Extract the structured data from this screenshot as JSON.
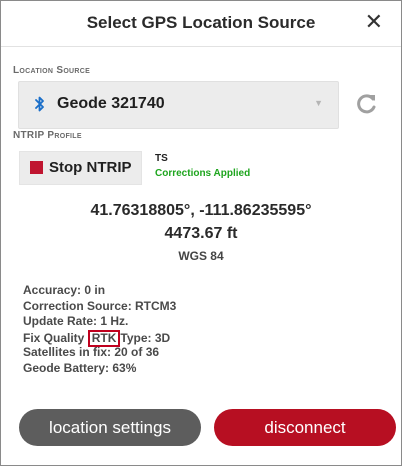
{
  "dialog": {
    "title": "Select GPS Location Source",
    "close_symbol": "✕"
  },
  "location_source": {
    "label": "Location Source",
    "selected": "Geode 321740",
    "icon": "bluetooth-icon",
    "refresh_icon": "refresh-icon"
  },
  "ntrip": {
    "label": "NTRIP Profile",
    "stop_label": "Stop NTRIP",
    "profile_name": "TS",
    "status": "Corrections Applied",
    "status_color": "#1ea51e"
  },
  "position": {
    "coordinates": "41.76318805°, -111.86235595°",
    "elevation": "4473.67 ft",
    "datum": "WGS 84"
  },
  "details": {
    "accuracy": "Accuracy: 0 in",
    "correction_source": "Correction Source: RTCM3",
    "update_rate": "Update Rate: 1 Hz.",
    "fix_quality_label": "Fix Quality",
    "fix_quality_value": "RTK",
    "fix_type": "Type: 3D",
    "satellites": "Satellites in fix: 20 of 36",
    "battery": "Geode Battery: 63%"
  },
  "buttons": {
    "settings": "location settings",
    "disconnect": "disconnect"
  },
  "colors": {
    "accent_red": "#b70f22",
    "bluetooth_blue": "#1b6fc9"
  }
}
